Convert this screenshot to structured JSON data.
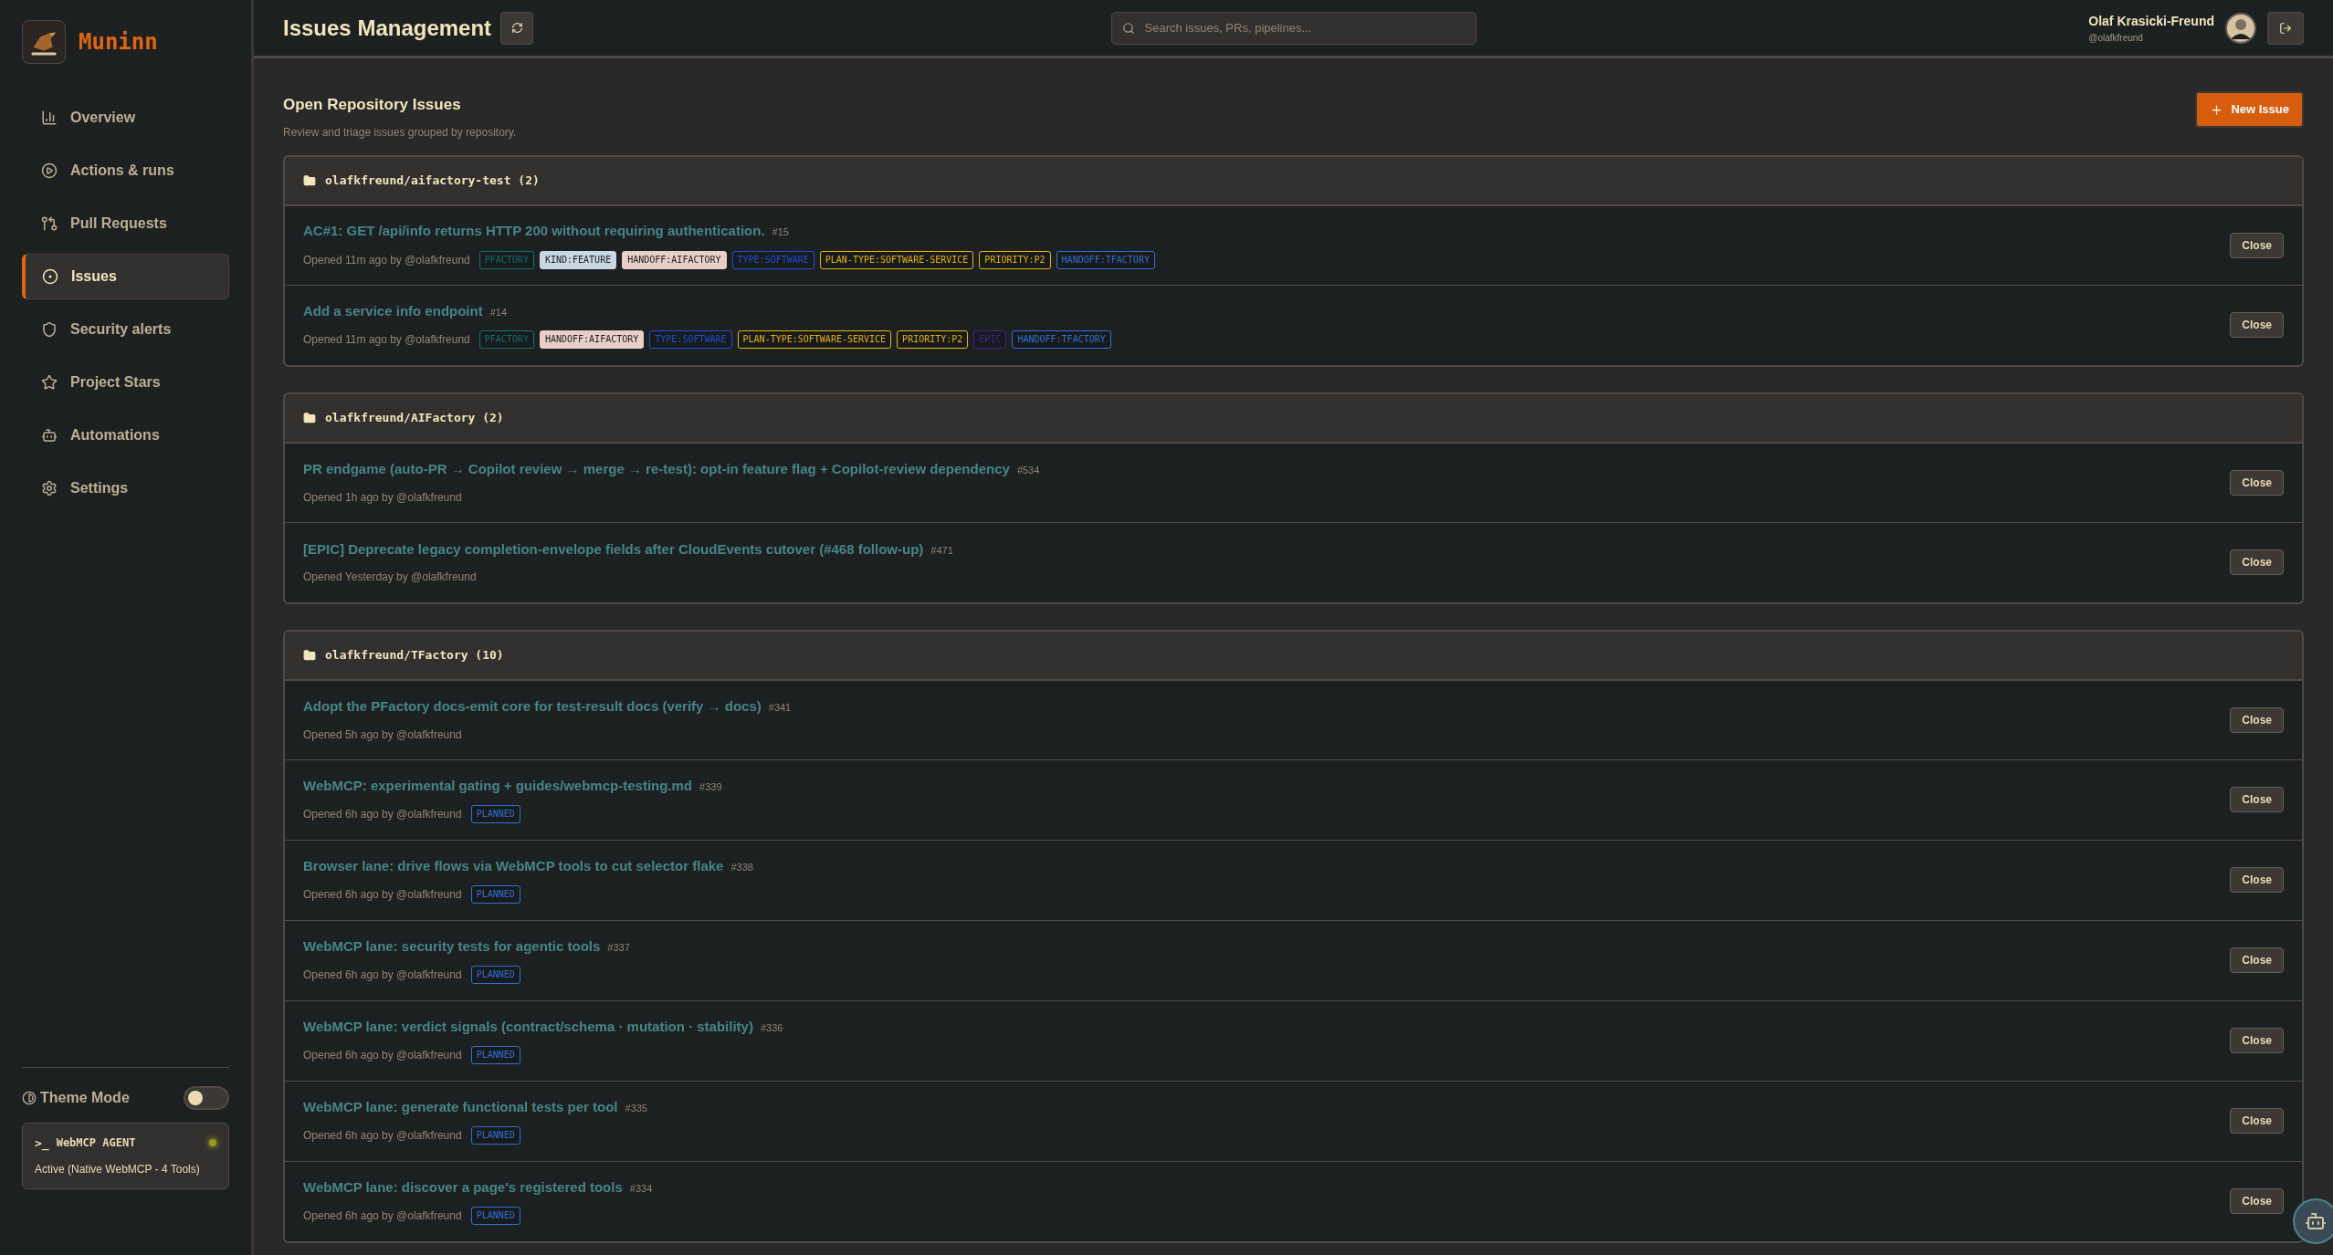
{
  "app": {
    "name": "Muninn"
  },
  "sidebar": {
    "items": [
      {
        "label": "Overview",
        "selected": false
      },
      {
        "label": "Actions & runs",
        "selected": false
      },
      {
        "label": "Pull Requests",
        "selected": false
      },
      {
        "label": "Issues",
        "selected": true
      },
      {
        "label": "Security alerts",
        "selected": false
      },
      {
        "label": "Project Stars",
        "selected": false
      },
      {
        "label": "Automations",
        "selected": false
      },
      {
        "label": "Settings",
        "selected": false
      }
    ]
  },
  "theme_mode": {
    "label": "Theme Mode",
    "on": false
  },
  "agent": {
    "prompt": ">_",
    "title": "WebMCP AGENT",
    "status": "Active (Native WebMCP - 4 Tools)",
    "active": true
  },
  "header": {
    "title": "Issues Management",
    "search": {
      "placeholder": "Search issues, PRs, pipelines..."
    },
    "user": {
      "name": "Olaf Krasicki-Freund",
      "handle": "@olafkfreund"
    }
  },
  "section": {
    "title": "Open Repository Issues",
    "subtitle": "Review and triage issues grouped by repository.",
    "new_button": "New Issue"
  },
  "groups": [
    {
      "name": "olafkfreund/aifactory-test (2)",
      "issues": [
        {
          "title": "AC#1: GET /api/info returns HTTP 200 without requiring authentication.",
          "number": "#15",
          "meta": "Opened 11m ago by @olafkfreund",
          "action": "Close",
          "tags": [
            {
              "label": "PFACTORY",
              "kind": "outline",
              "color": "#0f6e6e"
            },
            {
              "label": "KIND:FEATURE",
              "kind": "filled",
              "color": "#c9d6e3"
            },
            {
              "label": "HANDOFF:AIFACTORY",
              "kind": "filled",
              "color": "#e8cfc8"
            },
            {
              "label": "TYPE:SOFTWARE",
              "kind": "outline",
              "color": "#1d4ed8"
            },
            {
              "label": "PLAN-TYPE:SOFTWARE-SERVICE",
              "kind": "outline",
              "color": "#eab308"
            },
            {
              "label": "PRIORITY:P2",
              "kind": "outline",
              "color": "#eab308"
            },
            {
              "label": "HANDOFF:TFACTORY",
              "kind": "outline",
              "color": "#2f6fd6"
            }
          ]
        },
        {
          "title": "Add a service info endpoint",
          "number": "#14",
          "meta": "Opened 11m ago by @olafkfreund",
          "action": "Close",
          "tags": [
            {
              "label": "PFACTORY",
              "kind": "outline",
              "color": "#0f6e6e"
            },
            {
              "label": "HANDOFF:AIFACTORY",
              "kind": "filled",
              "color": "#e8cfc8"
            },
            {
              "label": "TYPE:SOFTWARE",
              "kind": "outline",
              "color": "#1d4ed8"
            },
            {
              "label": "PLAN-TYPE:SOFTWARE-SERVICE",
              "kind": "outline",
              "color": "#eab308"
            },
            {
              "label": "PRIORITY:P2",
              "kind": "outline",
              "color": "#eab308"
            },
            {
              "label": "EPIC",
              "kind": "outline",
              "color": "#4c1d95"
            },
            {
              "label": "HANDOFF:TFACTORY",
              "kind": "outline",
              "color": "#2f6fd6"
            }
          ]
        }
      ]
    },
    {
      "name": "olafkfreund/AIFactory (2)",
      "issues": [
        {
          "title": "PR endgame (auto-PR → Copilot review → merge → re-test): opt-in feature flag + Copilot-review dependency",
          "number": "#534",
          "meta": "Opened 1h ago by @olafkfreund",
          "action": "Close"
        },
        {
          "title": "[EPIC] Deprecate legacy completion-envelope fields after CloudEvents cutover (#468 follow-up)",
          "number": "#471",
          "meta": "Opened Yesterday by @olafkfreund",
          "action": "Close"
        }
      ]
    },
    {
      "name": "olafkfreund/TFactory (10)",
      "issues": [
        {
          "title": "Adopt the PFactory docs-emit core for test-result docs (verify → docs)",
          "number": "#341",
          "meta": "Opened 5h ago by @olafkfreund",
          "action": "Close"
        },
        {
          "title": "WebMCP: experimental gating + guides/webmcp-testing.md",
          "number": "#339",
          "meta": "Opened 6h ago by @olafkfreund",
          "action": "Close",
          "tags": [
            {
              "label": "PLANNED",
              "kind": "outline",
              "color": "#2f6fd6"
            }
          ]
        },
        {
          "title": "Browser lane: drive flows via WebMCP tools to cut selector flake",
          "number": "#338",
          "meta": "Opened 6h ago by @olafkfreund",
          "action": "Close",
          "tags": [
            {
              "label": "PLANNED",
              "kind": "outline",
              "color": "#2f6fd6"
            }
          ]
        },
        {
          "title": "WebMCP lane: security tests for agentic tools",
          "number": "#337",
          "meta": "Opened 6h ago by @olafkfreund",
          "action": "Close",
          "tags": [
            {
              "label": "PLANNED",
              "kind": "outline",
              "color": "#2f6fd6"
            }
          ]
        },
        {
          "title": "WebMCP lane: verdict signals (contract/schema · mutation · stability)",
          "number": "#336",
          "meta": "Opened 6h ago by @olafkfreund",
          "action": "Close",
          "tags": [
            {
              "label": "PLANNED",
              "kind": "outline",
              "color": "#2f6fd6"
            }
          ]
        },
        {
          "title": "WebMCP lane: generate functional tests per tool",
          "number": "#335",
          "meta": "Opened 6h ago by @olafkfreund",
          "action": "Close",
          "tags": [
            {
              "label": "PLANNED",
              "kind": "outline",
              "color": "#2f6fd6"
            }
          ]
        },
        {
          "title": "WebMCP lane: discover a page's registered tools",
          "number": "#334",
          "meta": "Opened 6h ago by @olafkfreund",
          "action": "Close",
          "tags": [
            {
              "label": "PLANNED",
              "kind": "outline",
              "color": "#2f6fd6"
            }
          ]
        }
      ]
    }
  ]
}
